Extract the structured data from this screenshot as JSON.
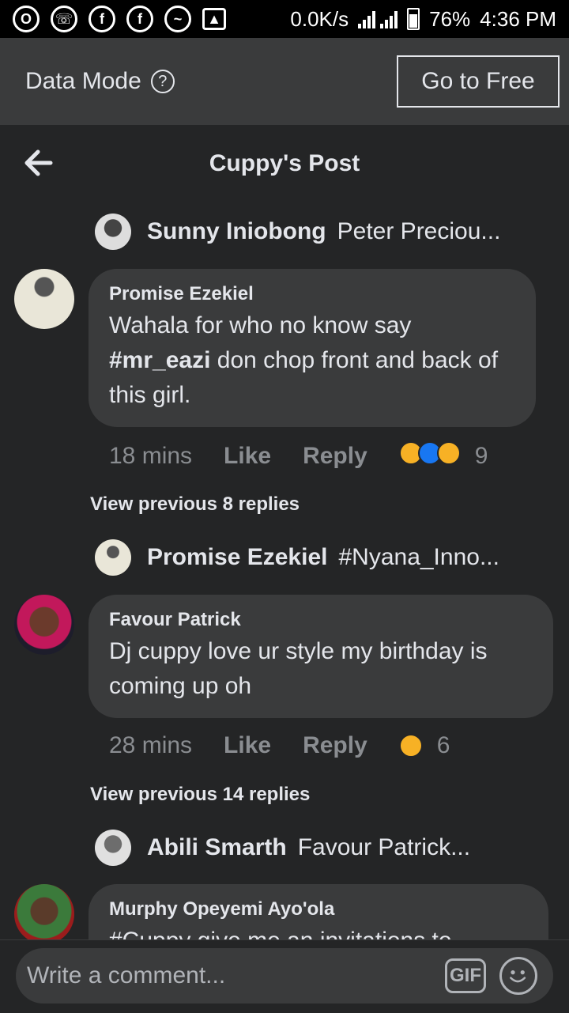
{
  "status_bar": {
    "net_speed": "0.0K/s",
    "battery": "76%",
    "time": "4:36 PM",
    "icons": [
      "opera-icon",
      "whatsapp-icon",
      "facebook-icon",
      "facebook-icon",
      "messenger-icon",
      "image-icon",
      "signal-icon",
      "battery-icon"
    ]
  },
  "data_mode": {
    "label": "Data Mode",
    "button": "Go to Free"
  },
  "header": {
    "title": "Cuppy's Post"
  },
  "threads": [
    {
      "reply_preview": {
        "name": "Sunny Iniobong",
        "text": "Peter Preciou..."
      },
      "comment": {
        "author": "Promise Ezekiel",
        "text_before": "Wahala for who no know say ",
        "hashtag": "#mr_eazi",
        "text_after": " don chop front and back of this girl.",
        "time": "18 mins",
        "like": "Like",
        "reply": "Reply",
        "reaction_count": "9"
      },
      "view_previous": "View previous 8 replies"
    },
    {
      "reply_preview": {
        "name": "Promise Ezekiel",
        "text": "#Nyana_Inno..."
      },
      "comment": {
        "author": "Favour Patrick",
        "text": "Dj cuppy love ur style my birthday is coming up oh",
        "time": "28 mins",
        "like": "Like",
        "reply": "Reply",
        "reaction_count": "6"
      },
      "view_previous": "View previous 14 replies"
    },
    {
      "reply_preview": {
        "name": "Abili Smarth",
        "text": "Favour Patrick..."
      },
      "comment": {
        "author": "Murphy Opeyemi Ayo'ola",
        "text": "#Cuppy give me an invitations to"
      }
    }
  ],
  "composer": {
    "placeholder": "Write a comment...",
    "gif": "GIF"
  },
  "colors": {
    "background": "#242526",
    "bubble": "#3a3b3c",
    "text": "#e4e6eb",
    "muted": "#8a8d91"
  }
}
